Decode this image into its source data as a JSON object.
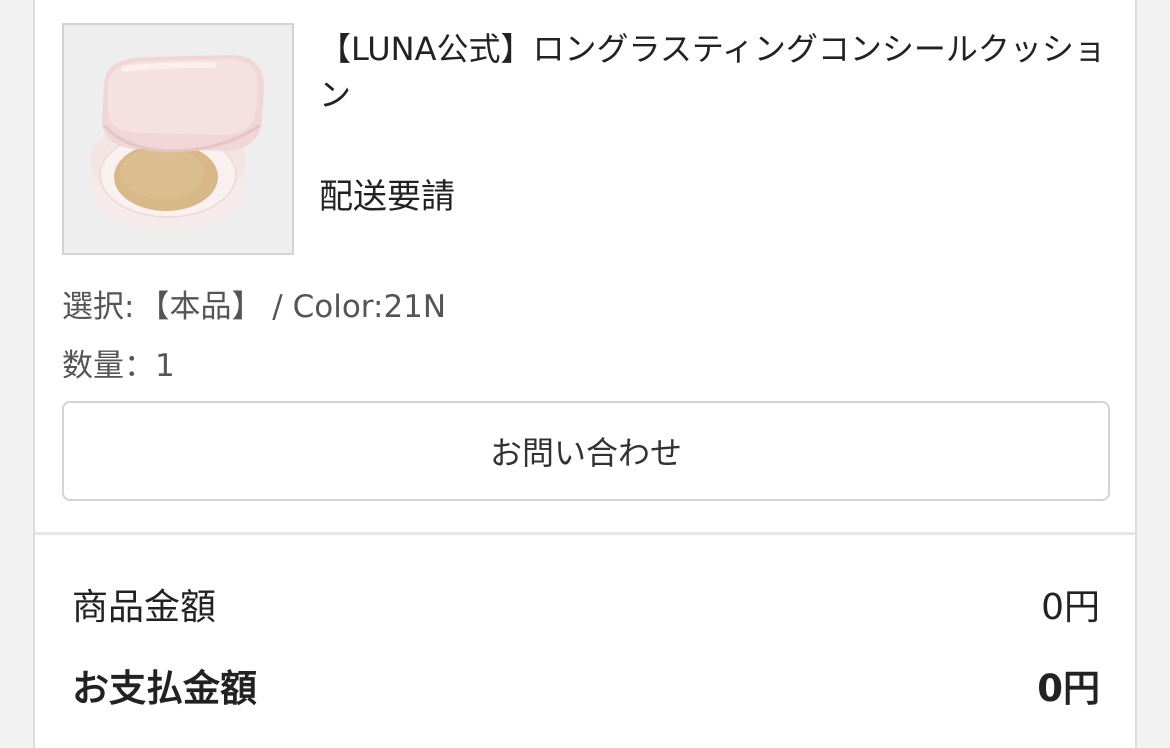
{
  "product": {
    "title": "【LUNA公式】ロングラスティングコンシールクッション",
    "status": "配送要請",
    "image_alt": "cushion compact"
  },
  "options": {
    "label": "選択:",
    "value": "【本品】 / Color:21N"
  },
  "quantity": {
    "label": "数量：",
    "value": "1"
  },
  "buttons": {
    "inquiry_label": "お問い合わせ"
  },
  "summary": {
    "subtotal_label": "商品金額",
    "subtotal_value": "0円",
    "total_label": "お支払金額",
    "total_value": "0円"
  },
  "colors": {
    "compact_pink": "#f1dcdc",
    "powder": "#d7b886",
    "border": "#d4d4d4"
  }
}
